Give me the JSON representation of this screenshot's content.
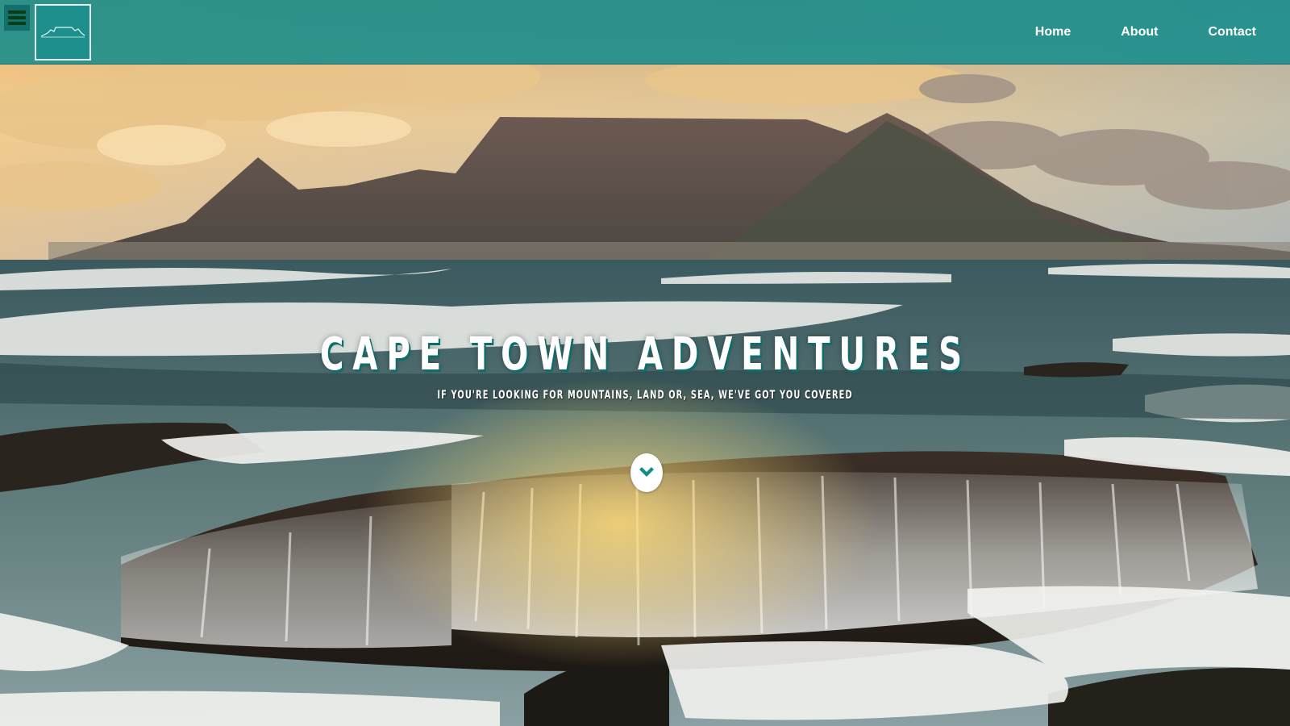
{
  "nav": {
    "menu_icon": "hamburger-menu-icon",
    "logo_icon": "table-mountain-logo",
    "links": [
      {
        "label": "Home"
      },
      {
        "label": "About"
      },
      {
        "label": "Contact"
      }
    ]
  },
  "hero": {
    "title": "CAPE TOWN ADVENTURES",
    "subtitle": "IF YOU'RE LOOKING FOR MOUNTAINS, LAND OR, SEA, WE'VE GOT YOU COVERED",
    "scroll_icon": "chevron-down-icon",
    "background_image": "table-mountain-ocean-waves"
  },
  "colors": {
    "navbar": "#148c8c",
    "title_shadow": "#0c6d6a",
    "menu_bars": "#0a3d16"
  }
}
